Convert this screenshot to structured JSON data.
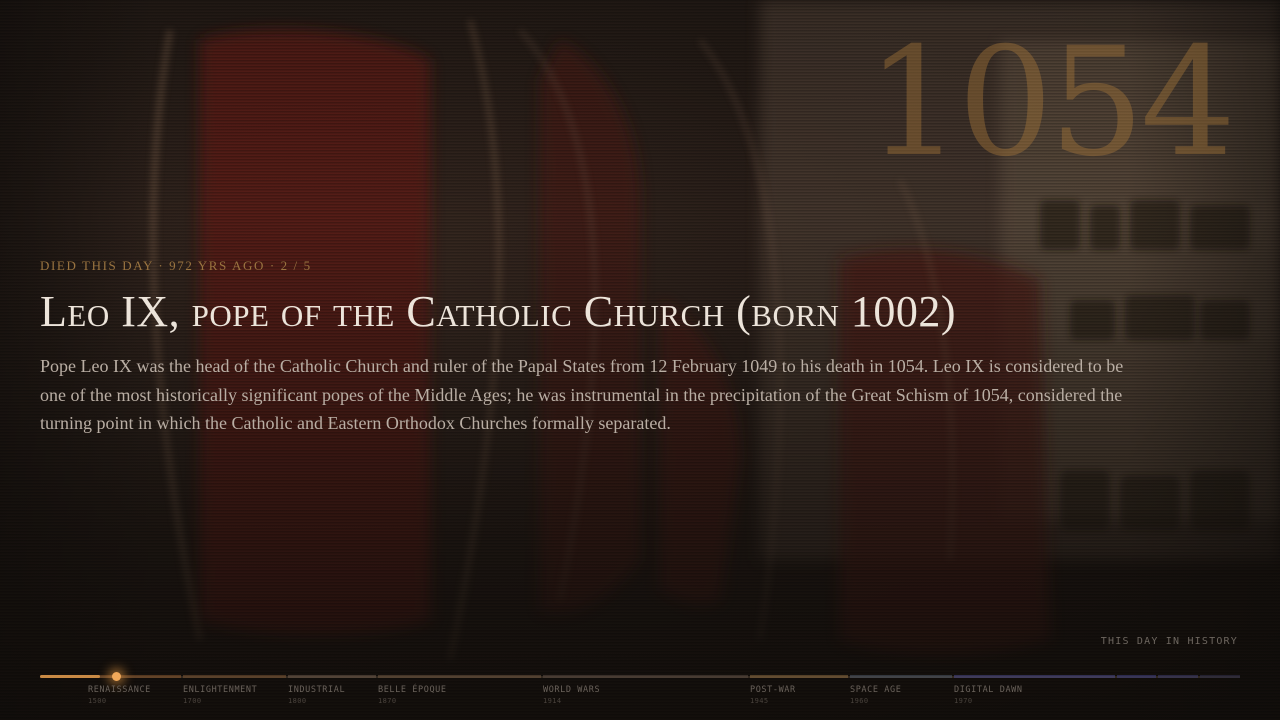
{
  "event": {
    "meta": "Died this day · 972 yrs ago · 2 / 5",
    "title": "Leo IX, pope of the Catholic Church (born 1002)",
    "description": "Pope Leo IX was the head of the Catholic Church and ruler of the Papal States from 12 February 1049 to his death in 1054. Leo IX is considered to be one of the most historically significant popes of the Middle Ages; he was instrumental in the precipitation of the Great Schism of 1054, considered the turning point in which the Catholic and Eastern Orthodox Churches formally separated.",
    "year": "1054"
  },
  "brand": {
    "label": "THIS DAY IN HISTORY"
  },
  "timeline": {
    "progress": 0.025,
    "progress_color": "#c98a45",
    "eras": [
      {
        "name": "RENAISSANCE",
        "year": "1500",
        "color": "#8a5a30"
      },
      {
        "name": "ENLIGHTENMENT",
        "year": "1700",
        "color": "#7a5535"
      },
      {
        "name": "INDUSTRIAL",
        "year": "1800",
        "color": "#6b5a4a"
      },
      {
        "name": "BELLE ÉPOQUE",
        "year": "1870",
        "color": "#6e5540"
      },
      {
        "name": "WORLD WARS",
        "year": "1914",
        "color": "#5a4a42"
      },
      {
        "name": "POST-WAR",
        "year": "1945",
        "color": "#8a6a40"
      },
      {
        "name": "SPACE AGE",
        "year": "1960",
        "color": "#4e5a68"
      },
      {
        "name": "DIGITAL DAWN",
        "year": "1970",
        "color": "#4a4a8a"
      }
    ]
  }
}
